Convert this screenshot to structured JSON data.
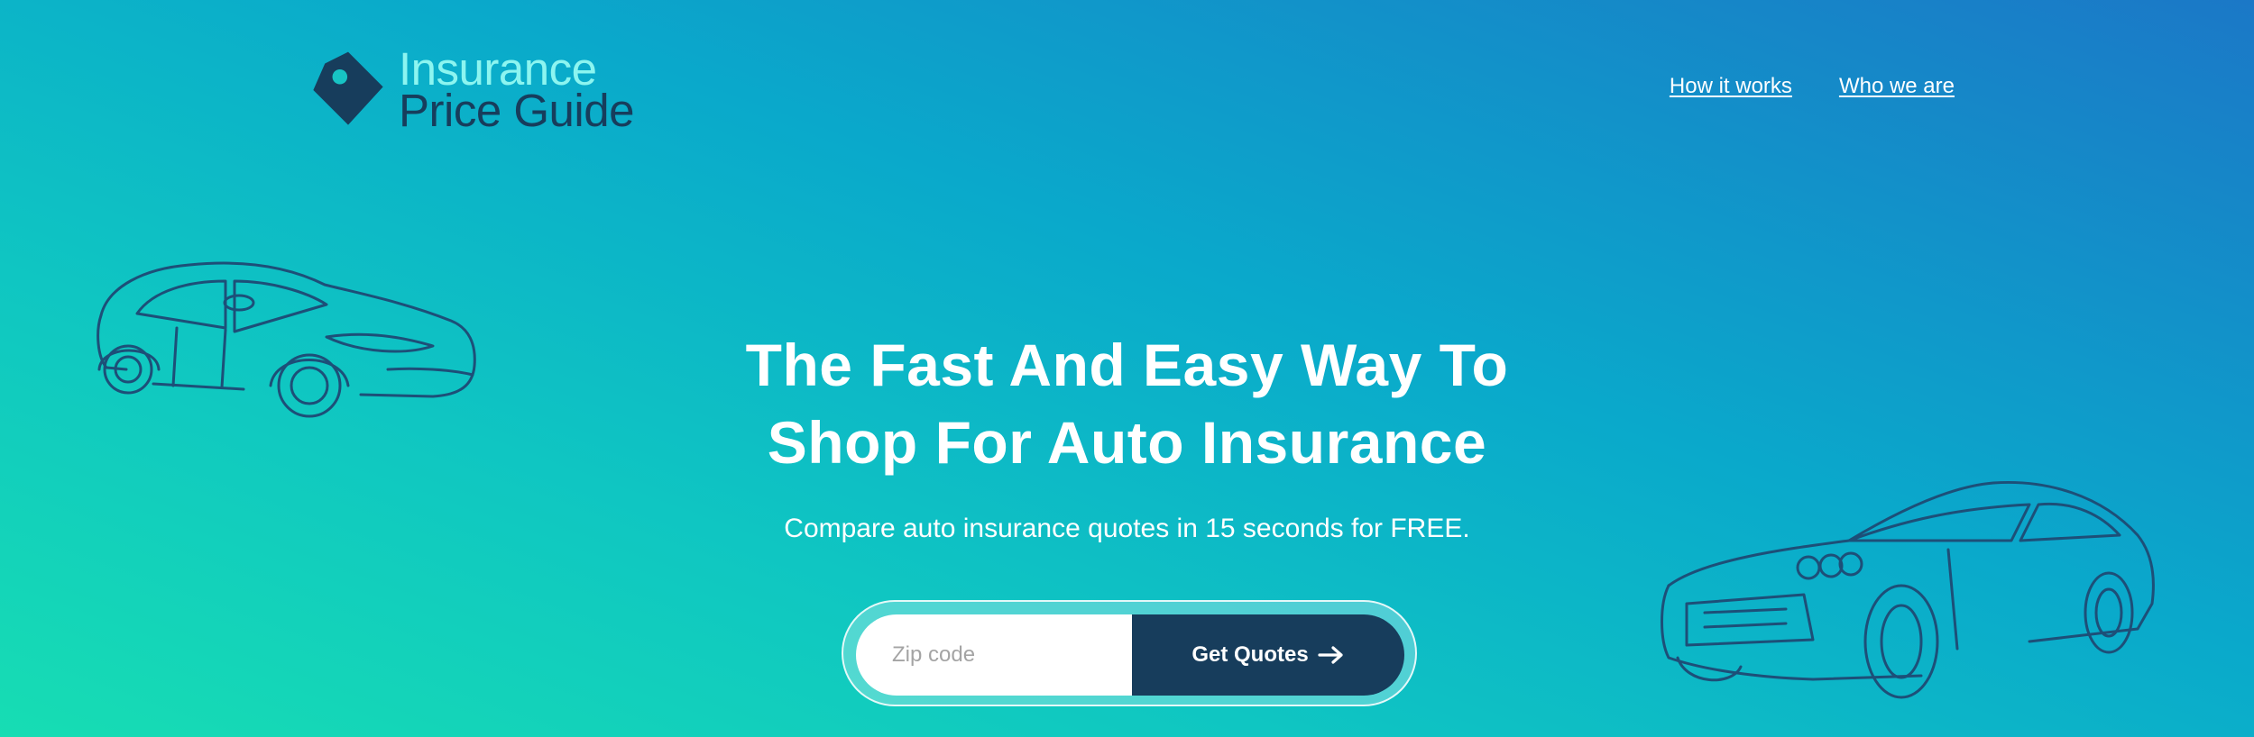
{
  "header": {
    "logo_line1": "Insurance",
    "logo_line2": "Price Guide",
    "logo_icon": "price-tag-icon",
    "nav": [
      {
        "label": "How it works"
      },
      {
        "label": "Who we are"
      }
    ]
  },
  "hero": {
    "title_line1": "The Fast And Easy Way To",
    "title_line2": "Shop For Auto Insurance",
    "subtitle": "Compare auto insurance quotes in 15 seconds for FREE.",
    "form": {
      "zip_placeholder": "Zip code",
      "zip_value": "",
      "button_label": "Get Quotes",
      "button_icon": "arrow-right-icon"
    }
  },
  "illustrations": [
    "sedan-outline-icon",
    "muscle-car-outline-icon"
  ],
  "colors": {
    "gradient_start": "#17ddb3",
    "gradient_end": "#1b78c7",
    "navy": "#173d5c",
    "logo_accent": "#8cf5f0",
    "car_stroke": "#1d4f78"
  }
}
